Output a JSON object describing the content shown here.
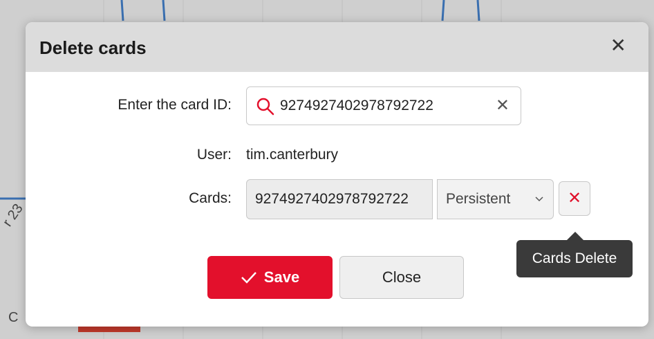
{
  "dialog": {
    "title": "Delete cards",
    "close_glyph": "✕"
  },
  "form": {
    "card_id_label": "Enter the card ID:",
    "card_id_value": "9274927402978792722",
    "search_icon": "search-icon",
    "clear_glyph": "✕",
    "user_label": "User:",
    "user_value": "tim.canterbury",
    "cards_label": "Cards:",
    "card_number": "9274927402978792722",
    "card_type": "Persistent",
    "delete_glyph": "✕",
    "delete_tooltip": "Cards Delete"
  },
  "footer": {
    "save_label": "Save",
    "close_label": "Close"
  },
  "background": {
    "axis_tick_partial": "r 23",
    "bottom_partial": "C"
  },
  "colors": {
    "accent": "#e3102c",
    "header_bg": "#dcdcdc",
    "tooltip_bg": "#3a3a3a"
  }
}
